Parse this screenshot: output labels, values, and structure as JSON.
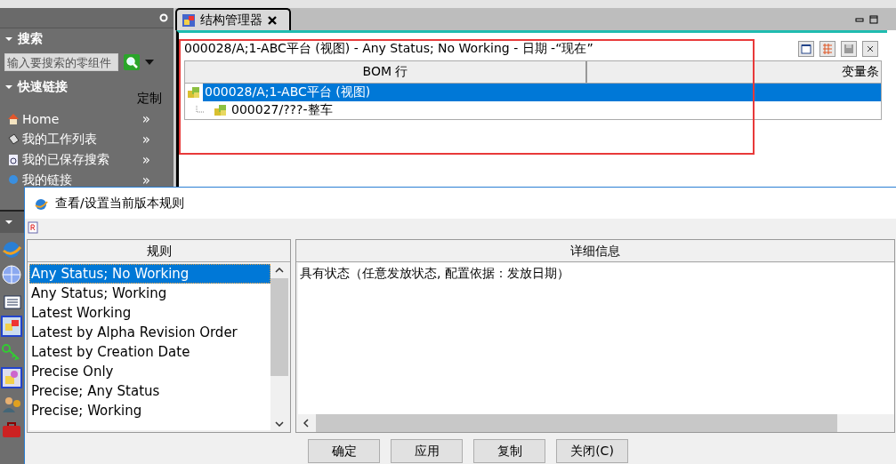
{
  "sidebar": {
    "search_section": {
      "title": "搜索",
      "expanded": true,
      "placeholder": "输入要搜索的零组件"
    },
    "quick_links": {
      "title": "快速链接",
      "expanded": true,
      "customize": "定制",
      "items": [
        {
          "label": "Home",
          "more": "»"
        },
        {
          "label": "我的工作列表",
          "more": "»"
        },
        {
          "label": "我的已保存搜索",
          "more": "»"
        },
        {
          "label": "我的链接",
          "more": "»"
        }
      ]
    }
  },
  "tab": {
    "title": "结构管理器"
  },
  "bom": {
    "header": "000028/A;1-ABC平台 (视图) - Any Status; No Working - 日期 -“现在”",
    "columns": [
      "BOM 行",
      "变量条"
    ],
    "rows": [
      {
        "label": "000028/A;1-ABC平台 (视图)",
        "selected": true,
        "children": [
          {
            "label": "000027/???-整车",
            "selected": false
          }
        ]
      }
    ]
  },
  "dialog": {
    "title": "查看/设置当前版本规则",
    "rules_header": "规则",
    "rules": [
      {
        "label": "Any Status; No Working",
        "selected": true
      },
      {
        "label": "Any Status; Working",
        "selected": false
      },
      {
        "label": "Latest Working",
        "selected": false
      },
      {
        "label": "Latest by Alpha Revision Order",
        "selected": false
      },
      {
        "label": "Latest by Creation Date",
        "selected": false
      },
      {
        "label": "Precise Only",
        "selected": false
      },
      {
        "label": "Precise; Any Status",
        "selected": false
      },
      {
        "label": "Precise; Working",
        "selected": false
      }
    ],
    "details_header": "详细信息",
    "details": "具有状态（任意发放状态, 配置依据：发放日期）",
    "buttons": [
      "确定",
      "应用",
      "复制",
      "关闭(C)"
    ]
  }
}
